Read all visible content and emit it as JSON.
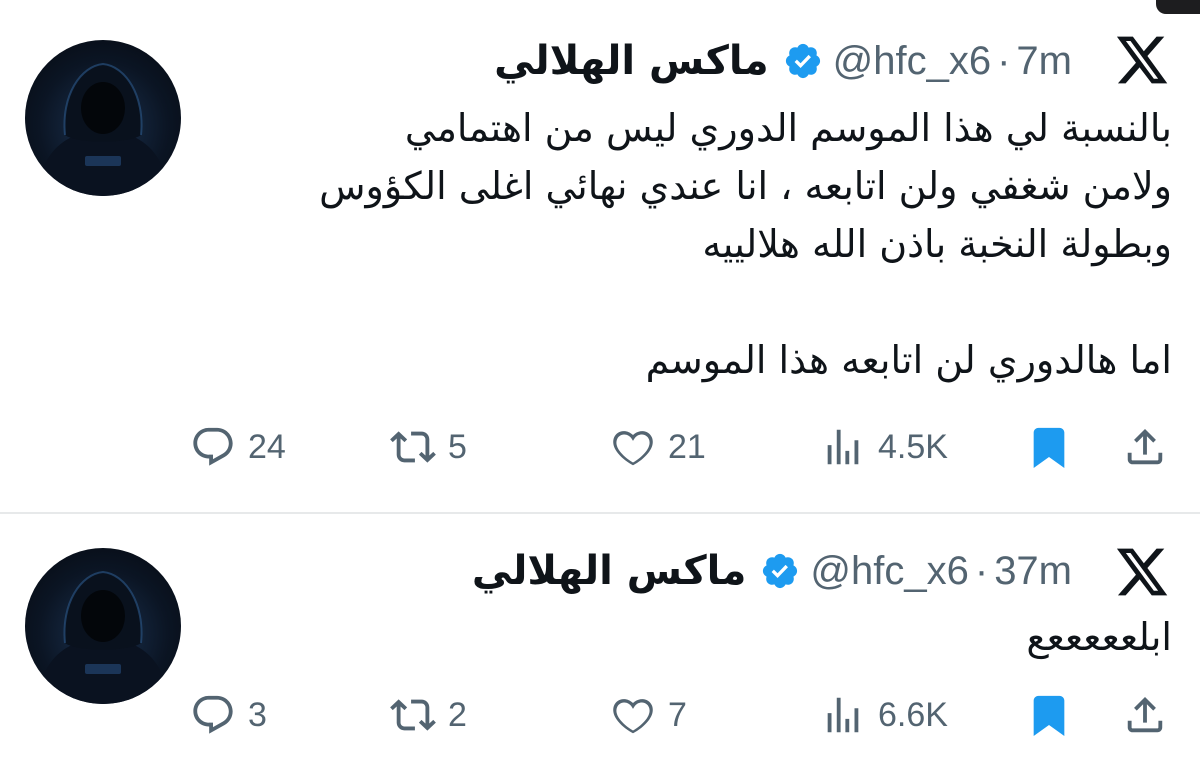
{
  "tweets": [
    {
      "display_name": "ماكس الهلالي",
      "handle": "@hfc_x6",
      "separator": "·",
      "time": "7m",
      "text": "بالنسبة لي هذا الموسم الدوري ليس من اهتمامي\nولامن شغفي ولن اتابعه ، انا عندي نهائي اغلى الكؤوس\nوبطولة النخبة باذن الله هلالييه\n\nاما هالدوري لن اتابعه هذا الموسم",
      "replies": "24",
      "retweets": "5",
      "likes": "21",
      "views": "4.5K",
      "bookmarked": true
    },
    {
      "display_name": "ماكس الهلالي",
      "handle": "@hfc_x6",
      "separator": "·",
      "time": "37m",
      "text": "ابلعععععع",
      "replies": "3",
      "retweets": "2",
      "likes": "7",
      "views": "6.6K",
      "bookmarked": true
    }
  ],
  "colors": {
    "text": "#0f1419",
    "secondary": "#536471",
    "verified": "#1d9bf0",
    "bookmark": "#1d9bf0",
    "divider": "#e7e9ea"
  },
  "icons": [
    "x-logo-icon",
    "verified-badge-icon",
    "reply-icon",
    "retweet-icon",
    "like-icon",
    "views-icon",
    "bookmark-icon",
    "share-icon"
  ]
}
